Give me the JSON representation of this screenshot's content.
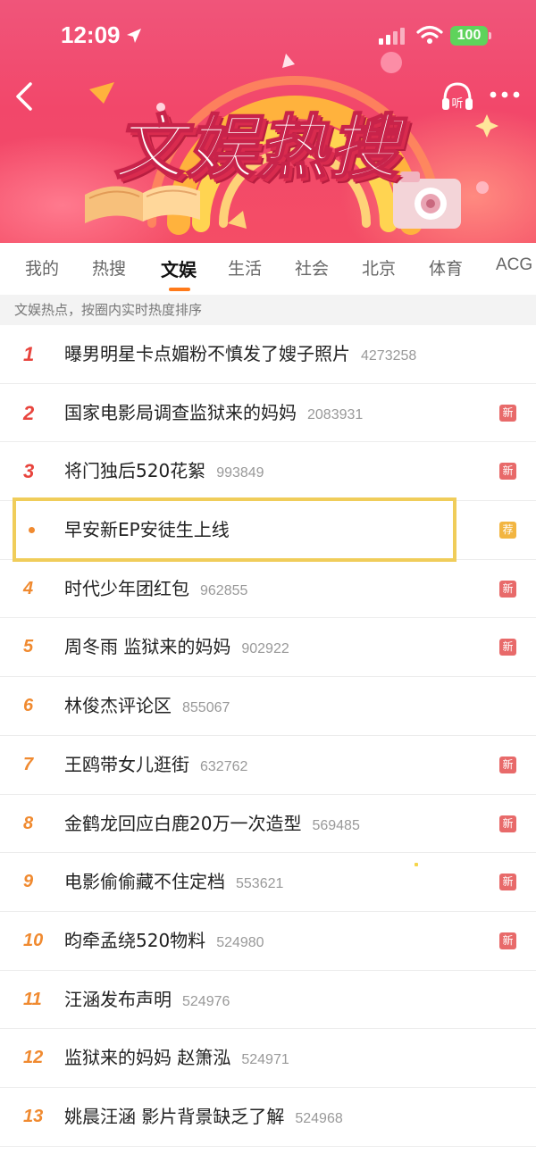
{
  "status_bar": {
    "time": "12:09",
    "battery": "100"
  },
  "banner": {
    "title": "文娱热搜",
    "listen_label": "听"
  },
  "tabs": [
    {
      "label": "我的",
      "active": false
    },
    {
      "label": "热搜",
      "active": false
    },
    {
      "label": "文娱",
      "active": true
    },
    {
      "label": "生活",
      "active": false
    },
    {
      "label": "社会",
      "active": false
    },
    {
      "label": "北京",
      "active": false
    },
    {
      "label": "体育",
      "active": false
    },
    {
      "label": "ACG",
      "active": false
    }
  ],
  "hint": "文娱热点，按圈内实时热度排序",
  "list": [
    {
      "rank": "1",
      "title": "曝男明星卡点媚粉不慎发了嫂子照片",
      "count": "4273258",
      "badge": ""
    },
    {
      "rank": "2",
      "title": "国家电影局调查监狱来的妈妈",
      "count": "2083931",
      "badge": "新"
    },
    {
      "rank": "3",
      "title": "将门独后520花絮",
      "count": "993849",
      "badge": "新"
    },
    {
      "rank": "",
      "title": "早安新EP安徒生上线",
      "count": "",
      "badge": "荐"
    },
    {
      "rank": "4",
      "title": "时代少年团红包",
      "count": "962855",
      "badge": "新"
    },
    {
      "rank": "5",
      "title": "周冬雨 监狱来的妈妈",
      "count": "902922",
      "badge": "新"
    },
    {
      "rank": "6",
      "title": "林俊杰评论区",
      "count": "855067",
      "badge": ""
    },
    {
      "rank": "7",
      "title": "王鸥带女儿逛街",
      "count": "632762",
      "badge": "新"
    },
    {
      "rank": "8",
      "title": "金鹤龙回应白鹿20万一次造型",
      "count": "569485",
      "badge": "新"
    },
    {
      "rank": "9",
      "title": "电影偷偷藏不住定档",
      "count": "553621",
      "badge": "新"
    },
    {
      "rank": "10",
      "title": "昀牵孟绕520物料",
      "count": "524980",
      "badge": "新"
    },
    {
      "rank": "11",
      "title": "汪涵发布声明",
      "count": "524976",
      "badge": ""
    },
    {
      "rank": "12",
      "title": "监狱来的妈妈 赵箫泓",
      "count": "524971",
      "badge": ""
    },
    {
      "rank": "13",
      "title": "姚晨汪涵 影片背景缺乏了解",
      "count": "524968",
      "badge": ""
    }
  ]
}
